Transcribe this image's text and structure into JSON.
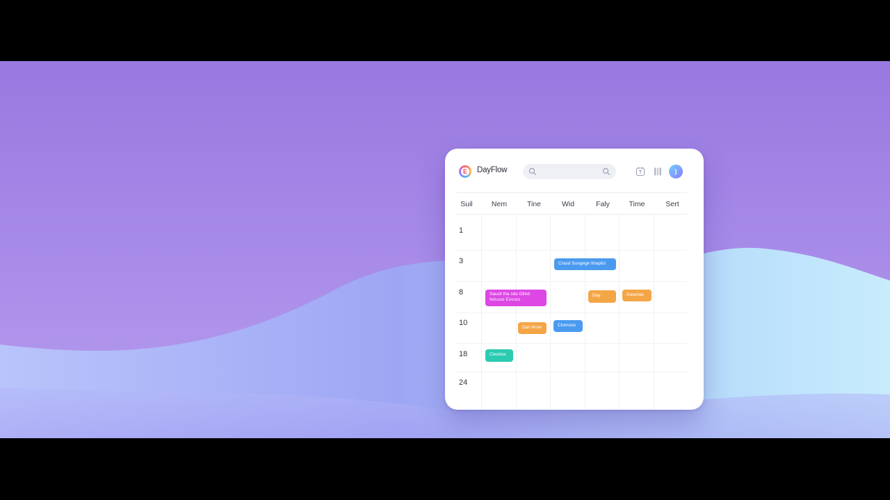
{
  "app": {
    "title": "DayFlow",
    "logo_letter": "E"
  },
  "search": {
    "value": "",
    "placeholder": ""
  },
  "toolbar": {
    "icons": [
      "calendar-icon",
      "columns-icon"
    ],
    "avatar_initial": ")"
  },
  "calendar": {
    "day_headers": [
      "Suil",
      "Nem",
      "Tine",
      "Wid",
      "Faly",
      "Time",
      "Sert"
    ],
    "row_labels": [
      "1",
      "3",
      "8",
      "10",
      "18",
      "24"
    ],
    "events": [
      {
        "label": "Crasd Sungege tihapful",
        "sub": "",
        "color": "#4a9af0"
      },
      {
        "label": "Saucil tha sdu Glind",
        "sub": "fwlusse Esvuss",
        "color": "#dd47e4"
      },
      {
        "label": "Day",
        "sub": "",
        "color": "#f4a646"
      },
      {
        "label": "Dawntas",
        "sub": "",
        "color": "#f4a646"
      },
      {
        "label": "Dan tinne",
        "sub": "",
        "color": "#f4a646"
      },
      {
        "label": "Clornose",
        "sub": "",
        "color": "#4a9af0"
      },
      {
        "label": "Clwslow",
        "sub": "",
        "color": "#2bcbb1"
      }
    ]
  },
  "colors": {
    "background_top": "#9879e0",
    "wave_light": "#c5e9fb",
    "accent": "#8a7bff"
  }
}
